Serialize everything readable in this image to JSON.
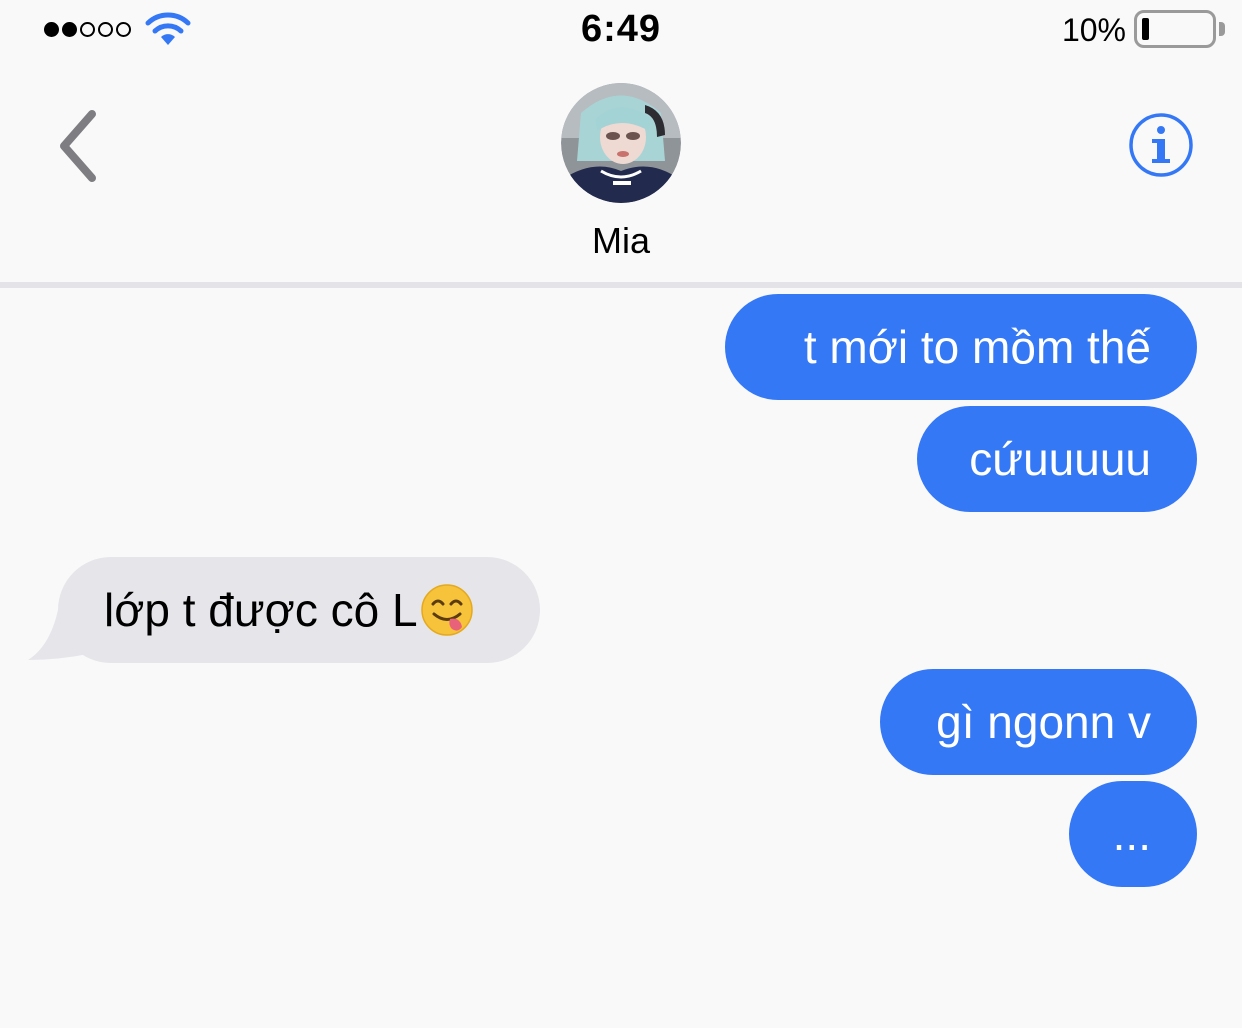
{
  "status_bar": {
    "signal_bars_filled": 2,
    "signal_bars_total": 5,
    "time": "6:49",
    "battery_percent": "10%",
    "battery_level": 0.1,
    "wifi_icon": "wifi-icon"
  },
  "header": {
    "back_icon": "chevron-left-icon",
    "contact_name": "Mia",
    "info_icon": "info-icon"
  },
  "messages": [
    {
      "direction": "sent",
      "text": "t mới to mồm thế"
    },
    {
      "direction": "sent",
      "text": "cứuuuuu"
    },
    {
      "direction": "received",
      "text": "lớp t được cô L",
      "emoji": "yum-face-emoji"
    },
    {
      "direction": "sent",
      "text": "gì ngonn v"
    },
    {
      "direction": "sent",
      "text": "..."
    }
  ],
  "colors": {
    "sent_bubble": "#3478f6",
    "received_bubble": "#e6e5ea",
    "accent": "#3478f6",
    "background": "#f9f9f9"
  }
}
